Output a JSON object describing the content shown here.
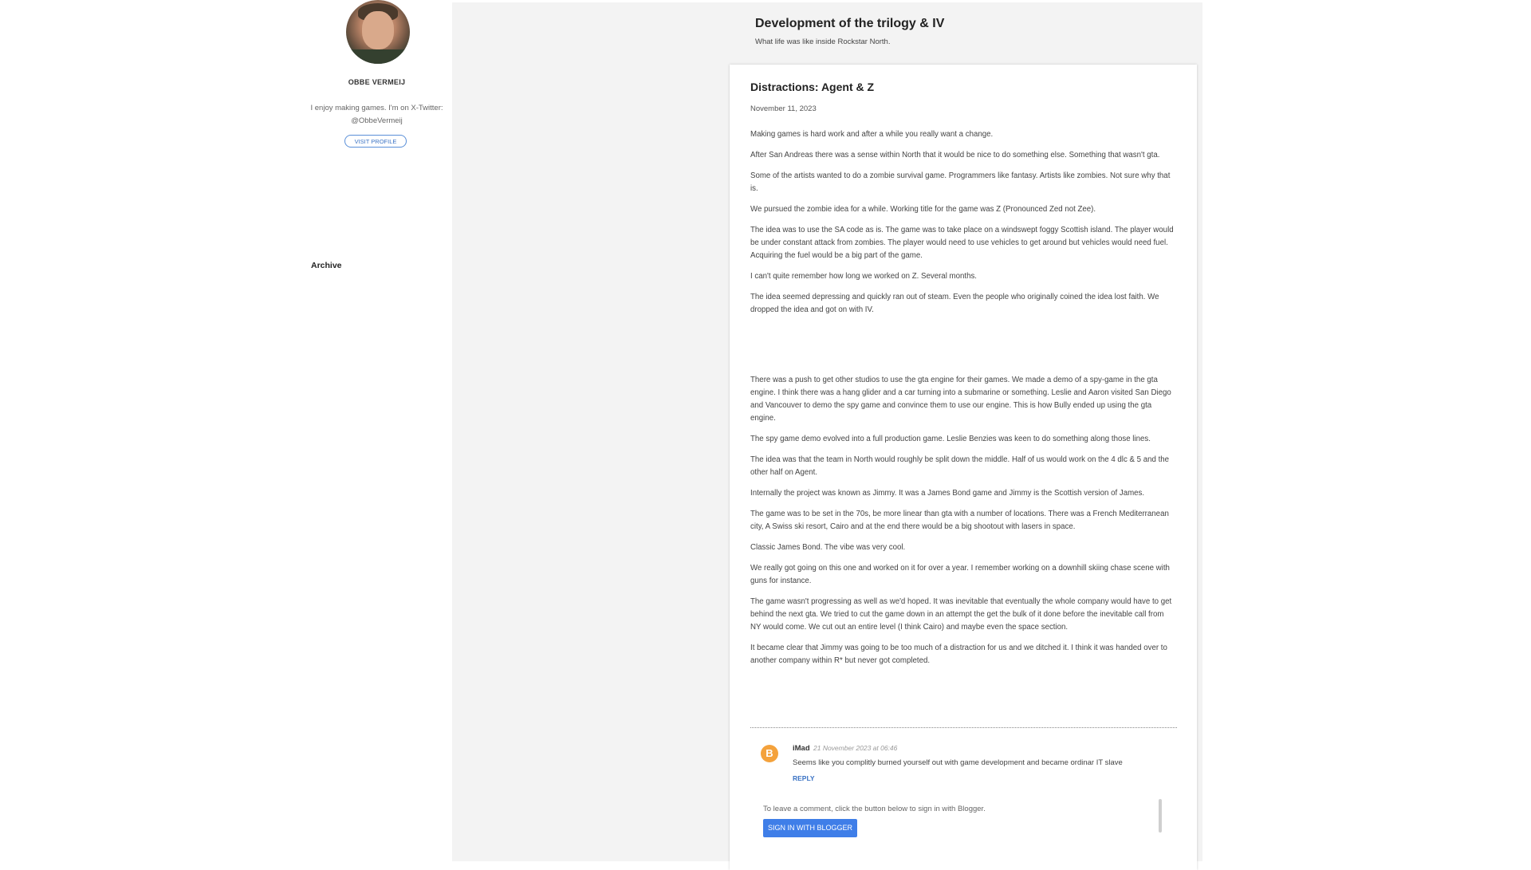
{
  "sidebar": {
    "profile_name": "OBBE VERMEIJ",
    "profile_desc_line1": "I enjoy making games. I'm on X-Twitter:",
    "profile_desc_line2": "@ObbeVermeij",
    "visit_profile": "VISIT PROFILE",
    "archive_title": "Archive"
  },
  "header": {
    "title": "Development of the trilogy & IV",
    "description": "What life was like inside Rockstar North."
  },
  "post": {
    "title": "Distractions: Agent & Z",
    "date": "November 11, 2023",
    "paragraphs": [
      "Making games is hard work and after a while you really want a change.",
      "After San Andreas there was a sense within North that it would be nice to do something else. Something that wasn't gta.",
      "Some of the artists wanted to do a zombie survival game. Programmers like fantasy. Artists like zombies. Not sure why that is.",
      "We pursued the zombie idea for a while. Working title for the game was Z (Pronounced Zed not Zee).",
      "The idea was to use the SA code as is. The game was to take place on a windswept foggy Scottish island. The player would be under constant attack from zombies. The player would need to use vehicles to get around but vehicles would need fuel. Acquiring the fuel would be a big part of the game.",
      "I can't quite remember how long we worked on Z. Several months.",
      "The idea seemed depressing and quickly ran out of steam. Even the people who originally coined the idea lost faith. We dropped the idea and got on with IV.",
      "There was a push to get other studios to use the gta engine for their games. We made a demo of a spy-game in the gta engine. I think there was a hang glider and a car turning into a submarine or something. Leslie and Aaron visited San Diego and Vancouver to demo the spy game and convince them to use our engine. This is how Bully ended up using the gta engine.",
      "The spy game demo evolved into a full production game. Leslie Benzies was keen to do something along those lines.",
      "The idea was that the team in North would roughly be split down the middle. Half of us would work on the 4 dlc & 5 and the other half on Agent.",
      "Internally the project was known as Jimmy. It was a James Bond game and Jimmy is the Scottish version of James.",
      "The game was to be set in the 70s, be more linear than gta with a number of locations. There was a French Mediterranean city, A Swiss ski resort, Cairo and at the end there would be a big shootout with lasers in space.",
      "Classic James Bond. The vibe was very cool.",
      "We really got going on this one and worked on it for over a year. I remember working on a downhill skiing chase scene with guns for instance.",
      "The game wasn't progressing as well as we'd hoped. It was inevitable that eventually the whole company would have to get behind the next gta. We tried to cut the game down in an attempt the get the bulk of it done before the inevitable call from NY would come. We cut out an entire level (I think Cairo) and maybe even the space section.",
      "It became clear that Jimmy was going to be too much of a distraction for us and we ditched it. I think it was handed over to another company within R* but never got completed."
    ]
  },
  "comment": {
    "avatar_glyph": "B",
    "author": "iMad",
    "date": "21 November 2023 at 06:46",
    "text": "Seems like you complitly burned yourself out with game development and became ordinar IT slave",
    "reply": "REPLY"
  },
  "signin": {
    "note": "To leave a comment, click the button below to sign in with Blogger.",
    "button": "SIGN IN WITH BLOGGER"
  },
  "colors": {
    "accent": "#3b73c4",
    "blogger_orange": "#f4a23c",
    "button_blue": "#3f7ee8",
    "main_bg": "#f3f3f3"
  }
}
